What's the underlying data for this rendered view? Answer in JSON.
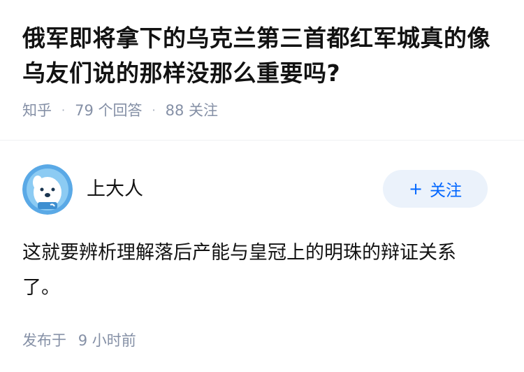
{
  "question": {
    "title": "俄军即将拿下的乌克兰第三首都红军城真的像乌友们说的那样没那么重要吗?",
    "source": "知乎",
    "answers_count": "79 个回答",
    "followers_count": "88 关注"
  },
  "answer": {
    "author_name": "上大人",
    "follow_icon": "plus-icon",
    "follow_label": "关注",
    "content": "这就要辨析理解落后产能与皇冠上的明珠的辩证关系了。",
    "published_label": "发布于",
    "published_time": "9 小时前"
  },
  "colors": {
    "accent": "#0066ff",
    "follow_bg": "#ebf2fb",
    "meta_text": "#8590a6",
    "title_text": "#121212"
  }
}
